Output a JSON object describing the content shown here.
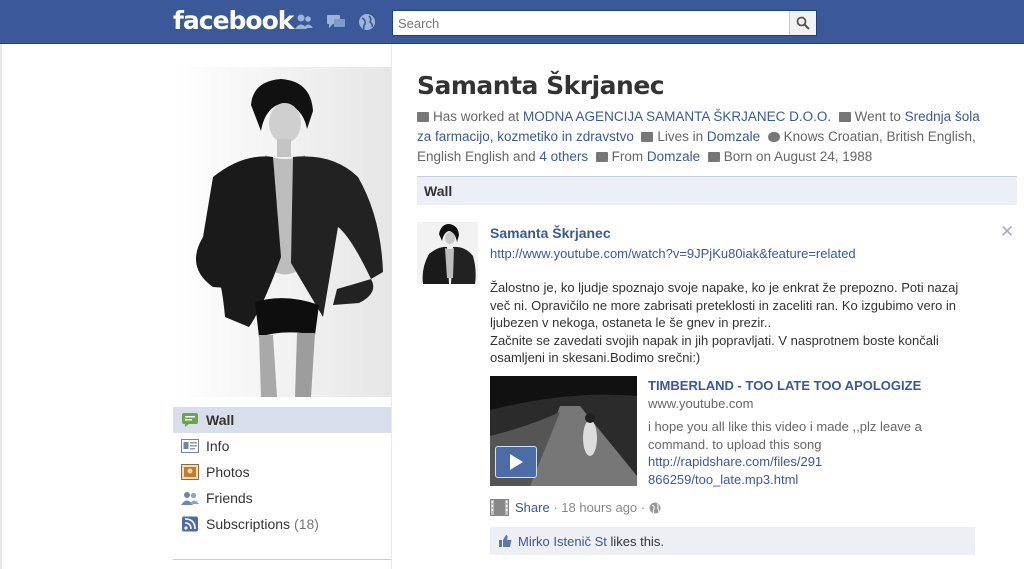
{
  "topbar": {
    "logo": "facebook",
    "search_placeholder": "Search"
  },
  "profile": {
    "name": "Samanta Škrjanec",
    "info": {
      "worked_prefix": "Has worked at ",
      "worked_at": "MODNA AGENCIJA SAMANTA ŠKRJANEC D.O.O.",
      "went_prefix": "Went to ",
      "school": "Srednja šola za farmacijo, kozmetiko in zdravstvo",
      "lives_prefix": "Lives in ",
      "lives_in": "Domzale",
      "knows": "Knows Croatian, British English, English English and ",
      "knows_more": "4 others",
      "from_prefix": "From ",
      "from": "Domzale",
      "born": "Born on August 24, 1988"
    }
  },
  "leftnav": {
    "items": [
      {
        "label": "Wall"
      },
      {
        "label": "Info"
      },
      {
        "label": "Photos"
      },
      {
        "label": "Friends"
      },
      {
        "label": "Subscriptions",
        "count": "(18)"
      }
    ]
  },
  "wall": {
    "header": "Wall",
    "story": {
      "author": "Samanta Škrjanec",
      "link": "http://www.youtube.com/watch?v=9JPjKu80iak&feature=related",
      "text_lines": [
        "Žalostno je, ko ljudje spoznajo svoje napake, ko je enkrat že prepozno. Poti nazaj več ni. Opravičilo ne more zabrisati preteklosti in zaceliti ran. Ko izgubimo vero in ljubezen v nekoga, ostaneta le še gnev in prezir..",
        "Začnite se zavedati svojih napak in jih popravljati. V nasprotnem boste končali osamljeni in skesani.Bodimo srečni:)"
      ],
      "attachment": {
        "title": "TIMBERLAND - TOO LATE TOO APOLOGIZE",
        "source": "www.youtube.com",
        "description": "i hope you all like this video i made ,,plz leave a command. to upload this song",
        "desc_link": "http://rapidshare.com/files/291866259/too_late.mp3.html"
      },
      "share_label": "Share",
      "time": "18 hours ago",
      "liker": "Mirko Istenič St",
      "likes_suffix": " likes this."
    }
  },
  "colors": {
    "brand": "#3b5998",
    "nav_active": "#d8dfea",
    "wall_header_bg": "#eceff5",
    "likes_bg": "#edeff4"
  }
}
